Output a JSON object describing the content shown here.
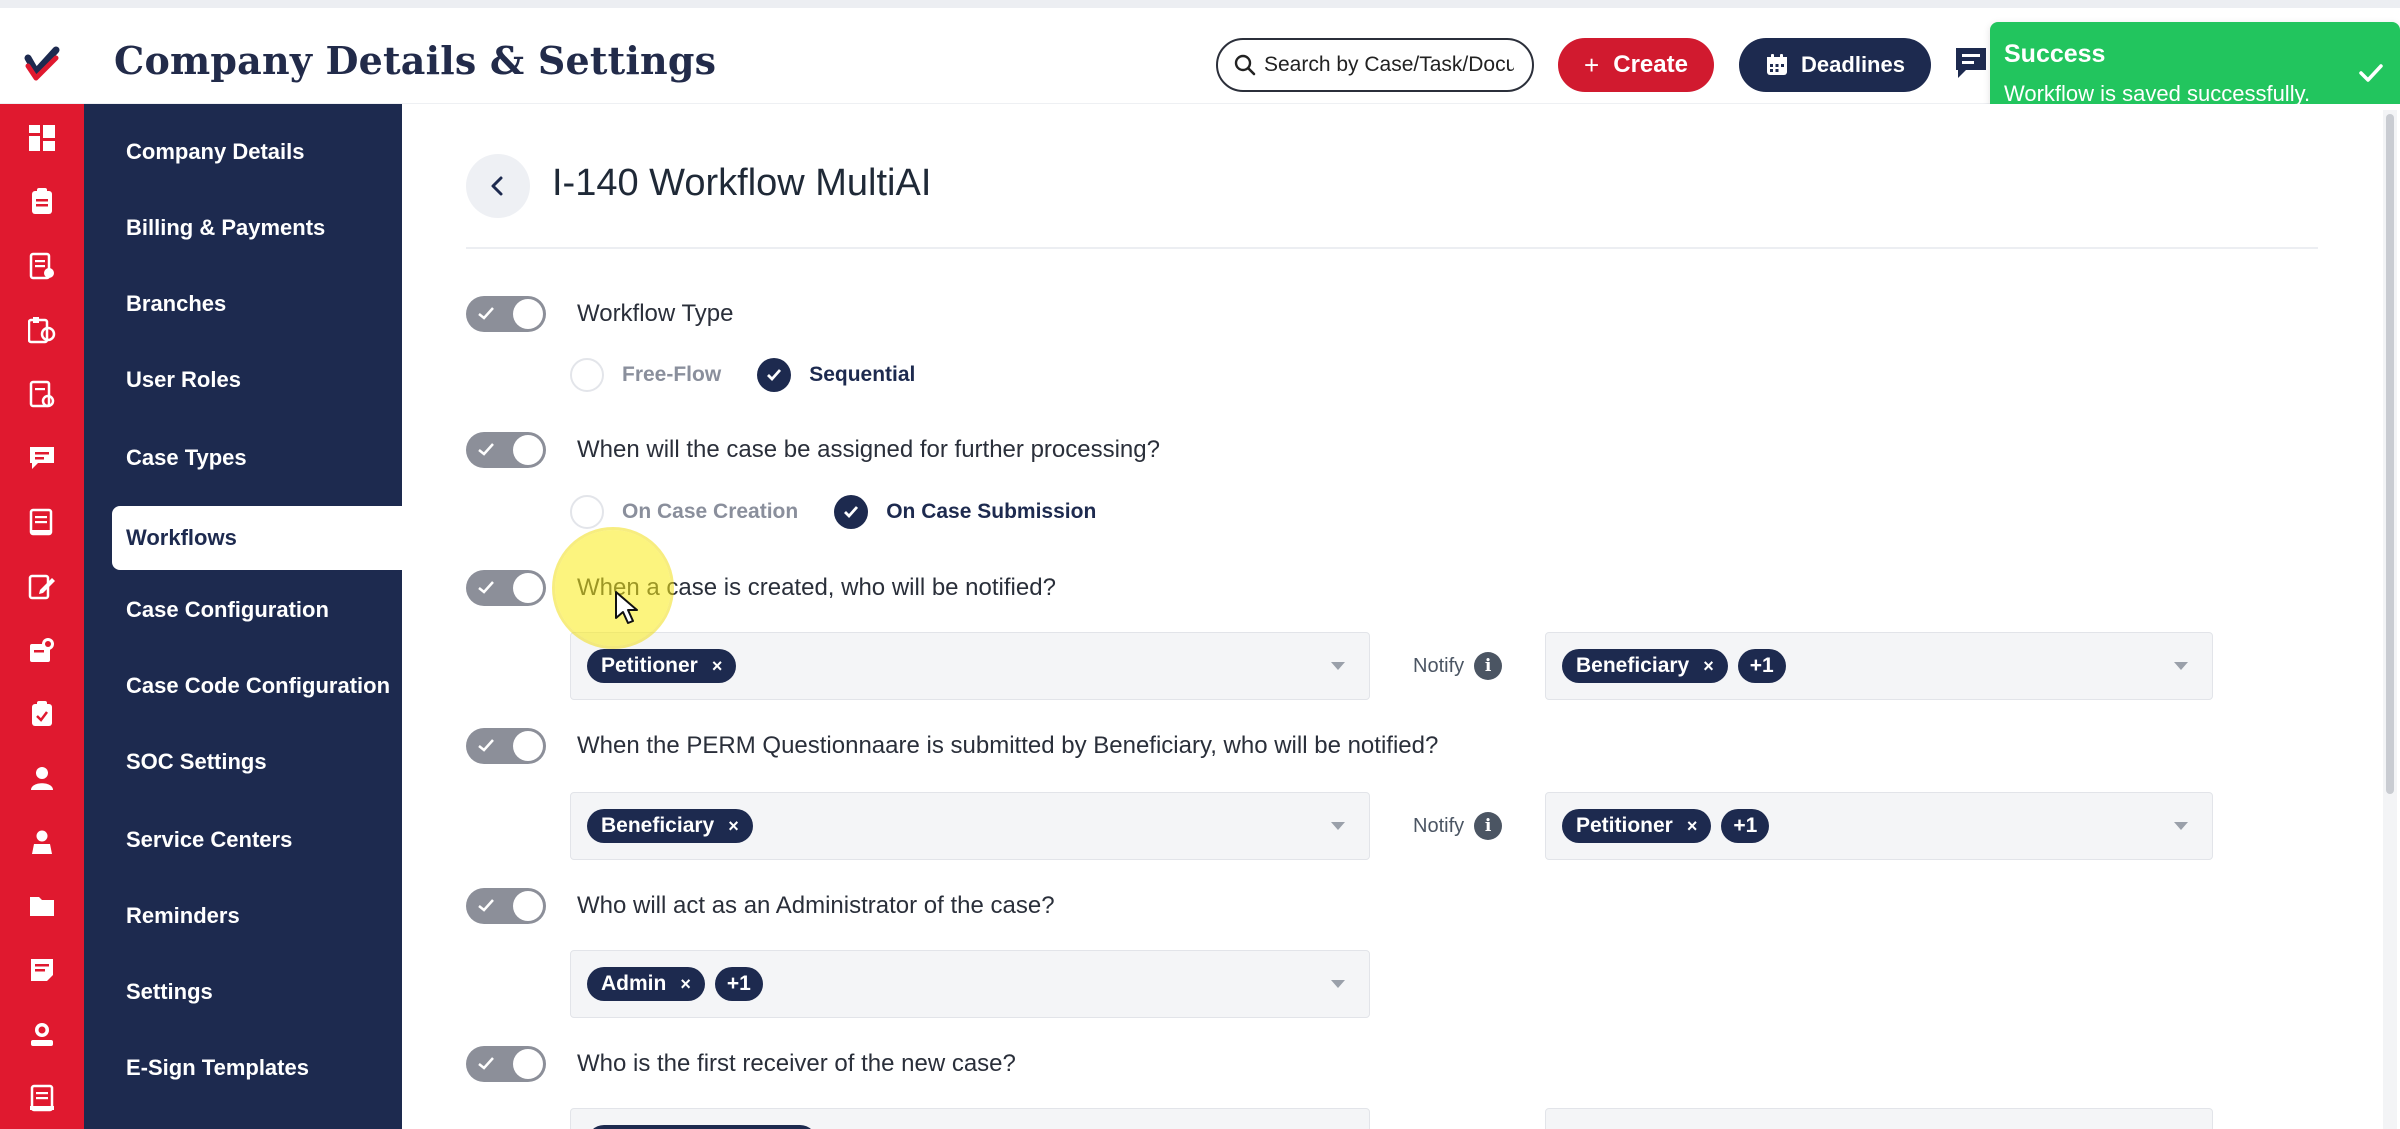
{
  "header": {
    "title": "Company Details & Settings",
    "search_placeholder": "Search by Case/Task/Document",
    "create_label": "Create",
    "deadlines_label": "Deadlines"
  },
  "toast": {
    "title": "Success",
    "message": "Workflow is saved successfully."
  },
  "rail_icons": [
    "dashboard-icon",
    "cases-icon",
    "documents-icon",
    "tasks-icon",
    "forms-icon",
    "messages-icon",
    "notes-icon",
    "edit-icon",
    "team-icon",
    "clipboard-icon",
    "user-icon",
    "contacts-icon",
    "folder-icon",
    "notes-alt-icon",
    "profile-icon",
    "reports-icon"
  ],
  "sidebar": {
    "items": [
      {
        "label": "Company Details"
      },
      {
        "label": "Billing & Payments"
      },
      {
        "label": "Branches"
      },
      {
        "label": "User Roles"
      },
      {
        "label": "Case Types"
      },
      {
        "label": "Workflows",
        "active": true
      },
      {
        "label": "Case Configuration"
      },
      {
        "label": "Case Code Configuration"
      },
      {
        "label": "SOC Settings"
      },
      {
        "label": "Service Centers"
      },
      {
        "label": "Reminders"
      },
      {
        "label": "Settings"
      },
      {
        "label": "E-Sign Templates"
      }
    ]
  },
  "main": {
    "title": "I-140 Workflow MultiAI",
    "q1": {
      "question": "Workflow Type",
      "enabled": true,
      "options": [
        {
          "label": "Free-Flow",
          "checked": false
        },
        {
          "label": "Sequential",
          "checked": true
        }
      ]
    },
    "q2": {
      "question": "When will the case be assigned for further processing?",
      "enabled": true,
      "options": [
        {
          "label": "On Case Creation",
          "checked": false
        },
        {
          "label": "On Case Submission",
          "checked": true
        }
      ]
    },
    "q3": {
      "question": "When a case is created, who will be notified?",
      "enabled": true,
      "left_chips": [
        "Petitioner"
      ],
      "notify_label": "Notify",
      "right_chips": [
        "Beneficiary"
      ],
      "right_more": "+1"
    },
    "q4": {
      "question": "When the PERM Questionnaare is submitted by Beneficiary, who will be notified?",
      "enabled": true,
      "left_chips": [
        "Beneficiary"
      ],
      "notify_label": "Notify",
      "right_chips": [
        "Petitioner"
      ],
      "right_more": "+1"
    },
    "q5": {
      "question": "Who will act as an Administrator of the case?",
      "enabled": true,
      "left_chips": [
        "Admin"
      ],
      "left_more": "+1"
    },
    "q6": {
      "question": "Who is the first receiver of the new case?",
      "enabled": true
    }
  },
  "colors": {
    "brand_red": "#e0192f",
    "navy": "#1d2a4f",
    "success": "#22c55e"
  }
}
